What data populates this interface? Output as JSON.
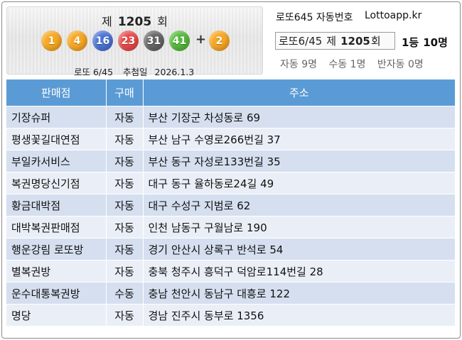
{
  "header": {
    "round_prefix": "제",
    "round_number": "1205",
    "round_suffix": "회",
    "balls": [
      {
        "value": "1",
        "color": "#f7a823"
      },
      {
        "value": "4",
        "color": "#f7a823"
      },
      {
        "value": "16",
        "color": "#4b74d6"
      },
      {
        "value": "23",
        "color": "#e94b4b"
      },
      {
        "value": "31",
        "color": "#666666"
      },
      {
        "value": "41",
        "color": "#55bb3b"
      }
    ],
    "plus": "+",
    "bonus_ball": {
      "value": "2",
      "color": "#f7a823"
    },
    "game_name": "로또 6/45",
    "draw_date_label": "추첨일",
    "draw_date": "2026.1.3"
  },
  "right_header": {
    "title": "로또645 자동번호",
    "site": "Lottoapp.kr",
    "round_box": {
      "game": "로또6/45",
      "prefix": "제",
      "number": "1205",
      "suffix": "회"
    },
    "winners": {
      "rank": "1등",
      "count": "10명"
    },
    "counts": {
      "auto": "자동 9명",
      "manual": "수동 1명",
      "semi": "반자동 0명"
    }
  },
  "table": {
    "columns": [
      "판매점",
      "구매",
      "주소"
    ],
    "rows": [
      {
        "shop": "기장슈퍼",
        "type": "자동",
        "address": "부산 기장군 차성동로 69"
      },
      {
        "shop": "평생꽃길대연점",
        "type": "자동",
        "address": "부산 남구 수영로266번길 37"
      },
      {
        "shop": "부일카서비스",
        "type": "자동",
        "address": "부산 동구 자성로133번길 35"
      },
      {
        "shop": "복권명당신기점",
        "type": "자동",
        "address": "대구 동구 율하동로24길 49"
      },
      {
        "shop": "황금대박점",
        "type": "자동",
        "address": "대구 수성구 지범로 62"
      },
      {
        "shop": "대박복권판매점",
        "type": "자동",
        "address": "인천 남동구 구월남로 190"
      },
      {
        "shop": "행운강림 로또방",
        "type": "자동",
        "address": "경기 안산시 상록구 반석로 54"
      },
      {
        "shop": "별복권방",
        "type": "자동",
        "address": "충북 청주시 흥덕구 덕암로114번길 28"
      },
      {
        "shop": "운수대통복권방",
        "type": "수동",
        "address": "충남 천안시 동남구 대흥로 122"
      },
      {
        "shop": "명당",
        "type": "자동",
        "address": "경남 진주시 동부로 1356"
      }
    ]
  }
}
